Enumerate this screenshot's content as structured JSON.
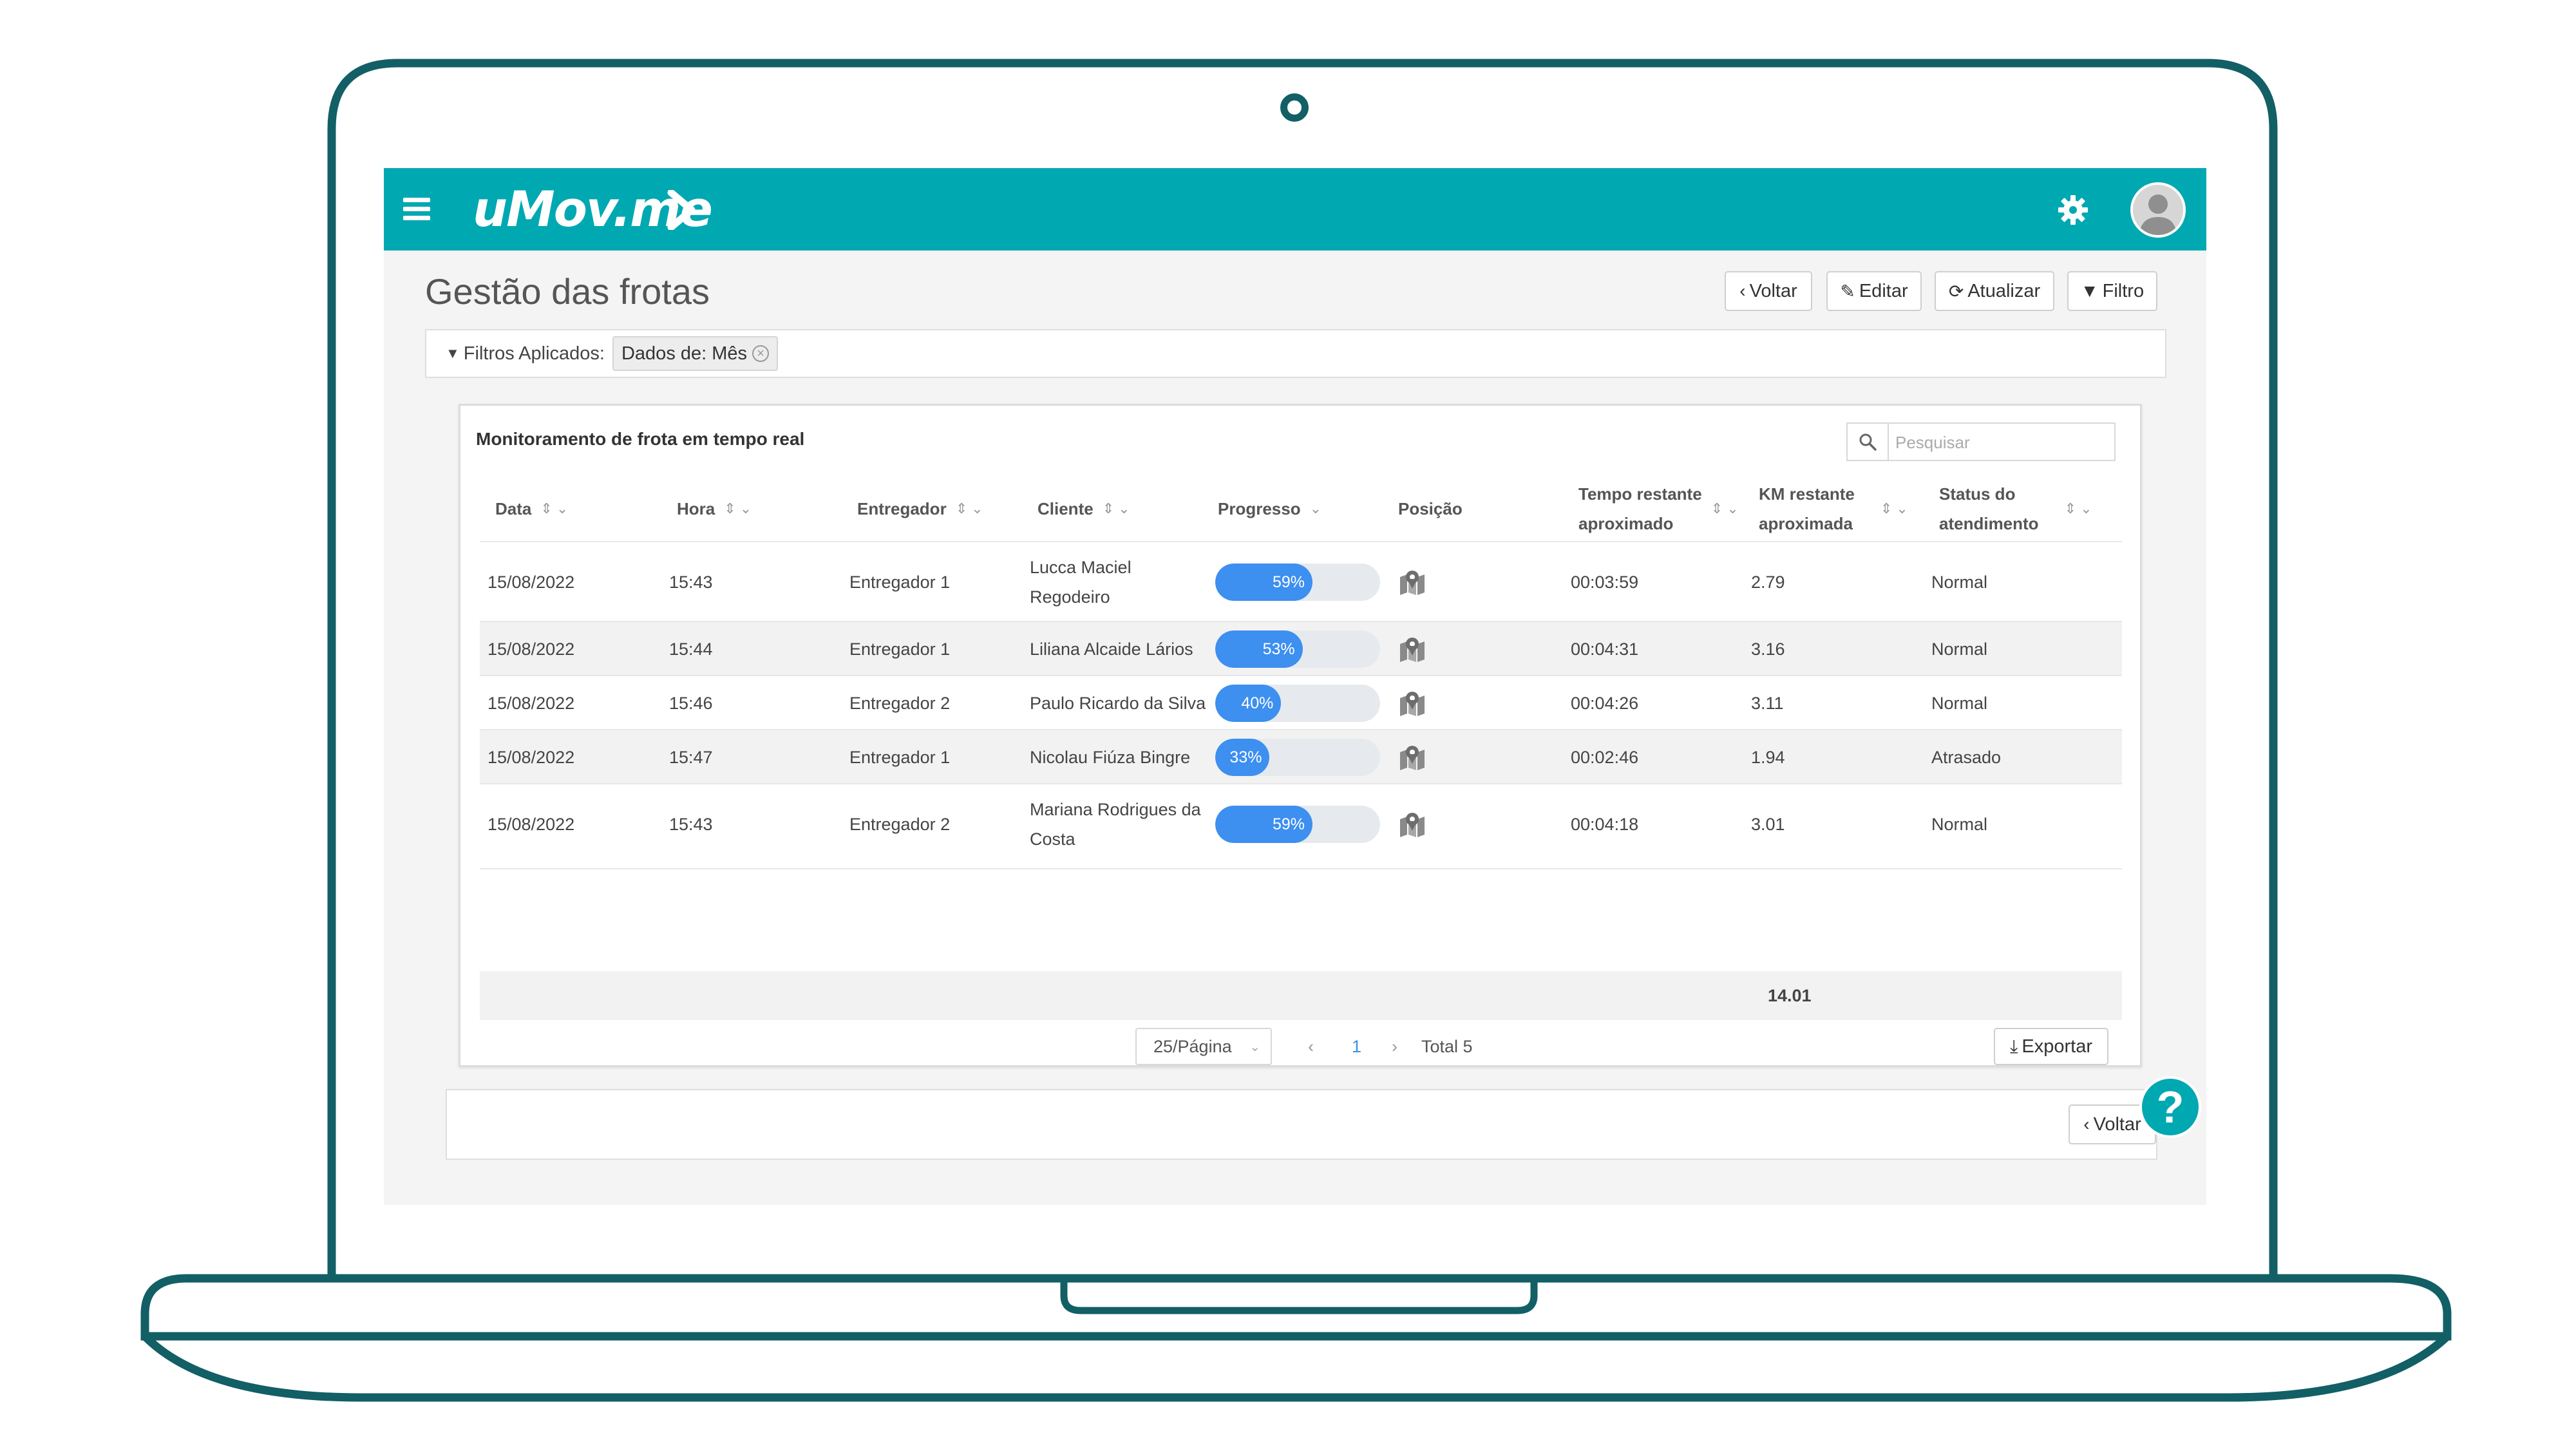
{
  "app": {
    "logo_text": "uMov.me",
    "brand_color": "#00a8b2",
    "frame_color": "#125f66"
  },
  "header": {
    "title": "Gestão das frotas",
    "buttons": {
      "back": "Voltar",
      "edit": "Editar",
      "refresh": "Atualizar",
      "filter": "Filtro"
    }
  },
  "filters": {
    "label": "Filtros Aplicados:",
    "chip": "Dados de: Mês"
  },
  "panel": {
    "title": "Monitoramento de frota em tempo real",
    "search_placeholder": "Pesquisar",
    "columns": {
      "data": "Data",
      "hora": "Hora",
      "entregador": "Entregador",
      "cliente": "Cliente",
      "progresso": "Progresso",
      "posicao": "Posição",
      "tempo_l1": "Tempo restante",
      "tempo_l2": "aproximado",
      "km_l1": "KM restante",
      "km_l2": "aproximada",
      "status_l1": "Status do",
      "status_l2": "atendimento"
    },
    "rows": [
      {
        "data": "15/08/2022",
        "hora": "15:43",
        "entregador": "Entregador 1",
        "cliente_l1": "Lucca Maciel",
        "cliente_l2": "Regodeiro",
        "progresso": 59,
        "progresso_label": "59%",
        "tempo": "00:03:59",
        "km": "2.79",
        "status": "Normal"
      },
      {
        "data": "15/08/2022",
        "hora": "15:44",
        "entregador": "Entregador 1",
        "cliente_l1": "Liliana Alcaide Lários",
        "cliente_l2": "",
        "progresso": 53,
        "progresso_label": "53%",
        "tempo": "00:04:31",
        "km": "3.16",
        "status": "Normal"
      },
      {
        "data": "15/08/2022",
        "hora": "15:46",
        "entregador": "Entregador 2",
        "cliente_l1": "Paulo Ricardo da Silva",
        "cliente_l2": "",
        "progresso": 40,
        "progresso_label": "40%",
        "tempo": "00:04:26",
        "km": "3.11",
        "status": "Normal"
      },
      {
        "data": "15/08/2022",
        "hora": "15:47",
        "entregador": "Entregador 1",
        "cliente_l1": "Nicolau Fiúza Bingre",
        "cliente_l2": "",
        "progresso": 33,
        "progresso_label": "33%",
        "tempo": "00:02:46",
        "km": "1.94",
        "status": "Atrasado"
      },
      {
        "data": "15/08/2022",
        "hora": "15:43",
        "entregador": "Entregador 2",
        "cliente_l1": "Mariana Rodrigues da",
        "cliente_l2": "Costa",
        "progresso": 59,
        "progresso_label": "59%",
        "tempo": "00:04:18",
        "km": "3.01",
        "status": "Normal"
      }
    ],
    "km_total": "14.01",
    "pagination": {
      "per_page": "25/Página",
      "current_page": "1",
      "total": "Total 5"
    },
    "export_label": "Exportar"
  },
  "bottom": {
    "back": "Voltar",
    "help": "?"
  },
  "progress_color": "#3d8ff0"
}
